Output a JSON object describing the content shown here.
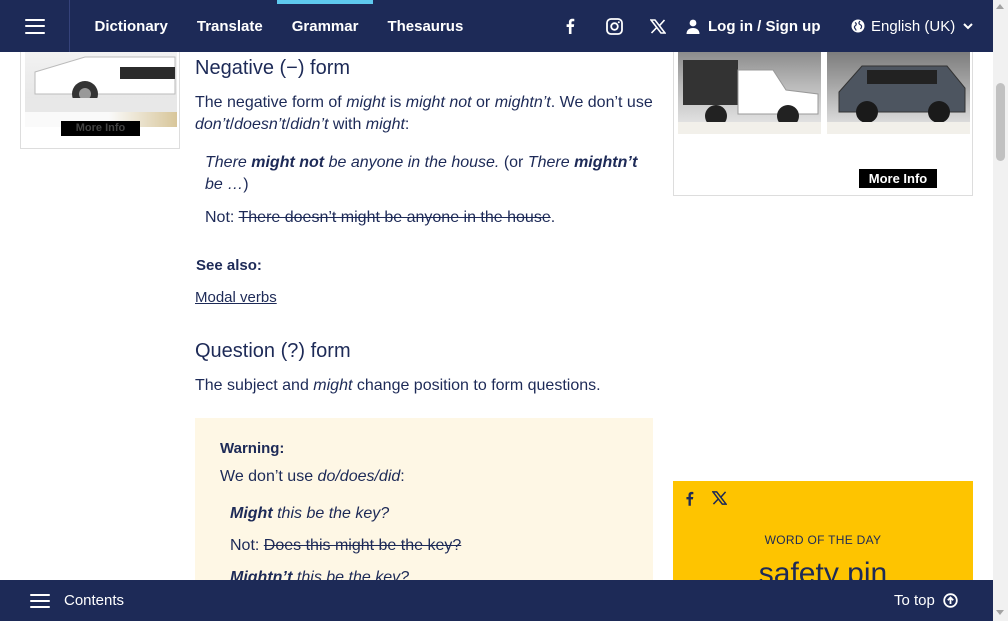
{
  "nav": {
    "links": [
      "Dictionary",
      "Translate",
      "Grammar",
      "Thesaurus"
    ],
    "active_index": 2,
    "login_label": "Log in / Sign up",
    "language_label": "English (UK)"
  },
  "colors": {
    "navy": "#1d2a57",
    "accent": "#5ec9ee",
    "warning_bg": "#fef7e5",
    "wotd_bg": "#fec400"
  },
  "ads": {
    "more_info_label": "More Info"
  },
  "article": {
    "negative_heading": "Negative (−) form",
    "negative_intro": {
      "t1": "The negative form of ",
      "i1": "might",
      "t2": " is ",
      "i2": "might not",
      "t3": " or ",
      "i3": "mightn’t",
      "t4": ". We don’t use ",
      "i4": "don’t",
      "t5": "/",
      "i5": "doesn’t",
      "t6": "/",
      "i6": "didn’t",
      "t7": " with ",
      "i7": "might",
      "t8": ":"
    },
    "example1": {
      "a": "There ",
      "b": "might not",
      "c": " be anyone in the house.",
      "d": " (or ",
      "e": "There ",
      "f": "mightn’t",
      "g": " be …",
      "h": ")"
    },
    "not_example": {
      "label": "Not: ",
      "text": "There doesn’t might be anyone in the house",
      "end": "."
    },
    "see_also_label": "See also:",
    "see_also_link": "Modal verbs",
    "question_heading": "Question (?) form",
    "question_intro": {
      "t1": "The subject and ",
      "i1": "might",
      "t2": " change position to form questions."
    }
  },
  "warning": {
    "title": "Warning:",
    "line1": {
      "t1": "We don’t use ",
      "i1": "do/does/did",
      "t2": ":"
    },
    "ex1": {
      "b": "Might",
      "i": " this be the key?"
    },
    "not_ex": {
      "label": "Not: ",
      "text": "Does this might be the key?"
    },
    "ex2": {
      "b": "Mightn’t",
      "i": " this be the key?"
    }
  },
  "wotd": {
    "label": "WORD OF THE DAY",
    "word": "safety pin"
  },
  "bottom": {
    "contents_label": "Contents",
    "totop_label": "To top"
  }
}
